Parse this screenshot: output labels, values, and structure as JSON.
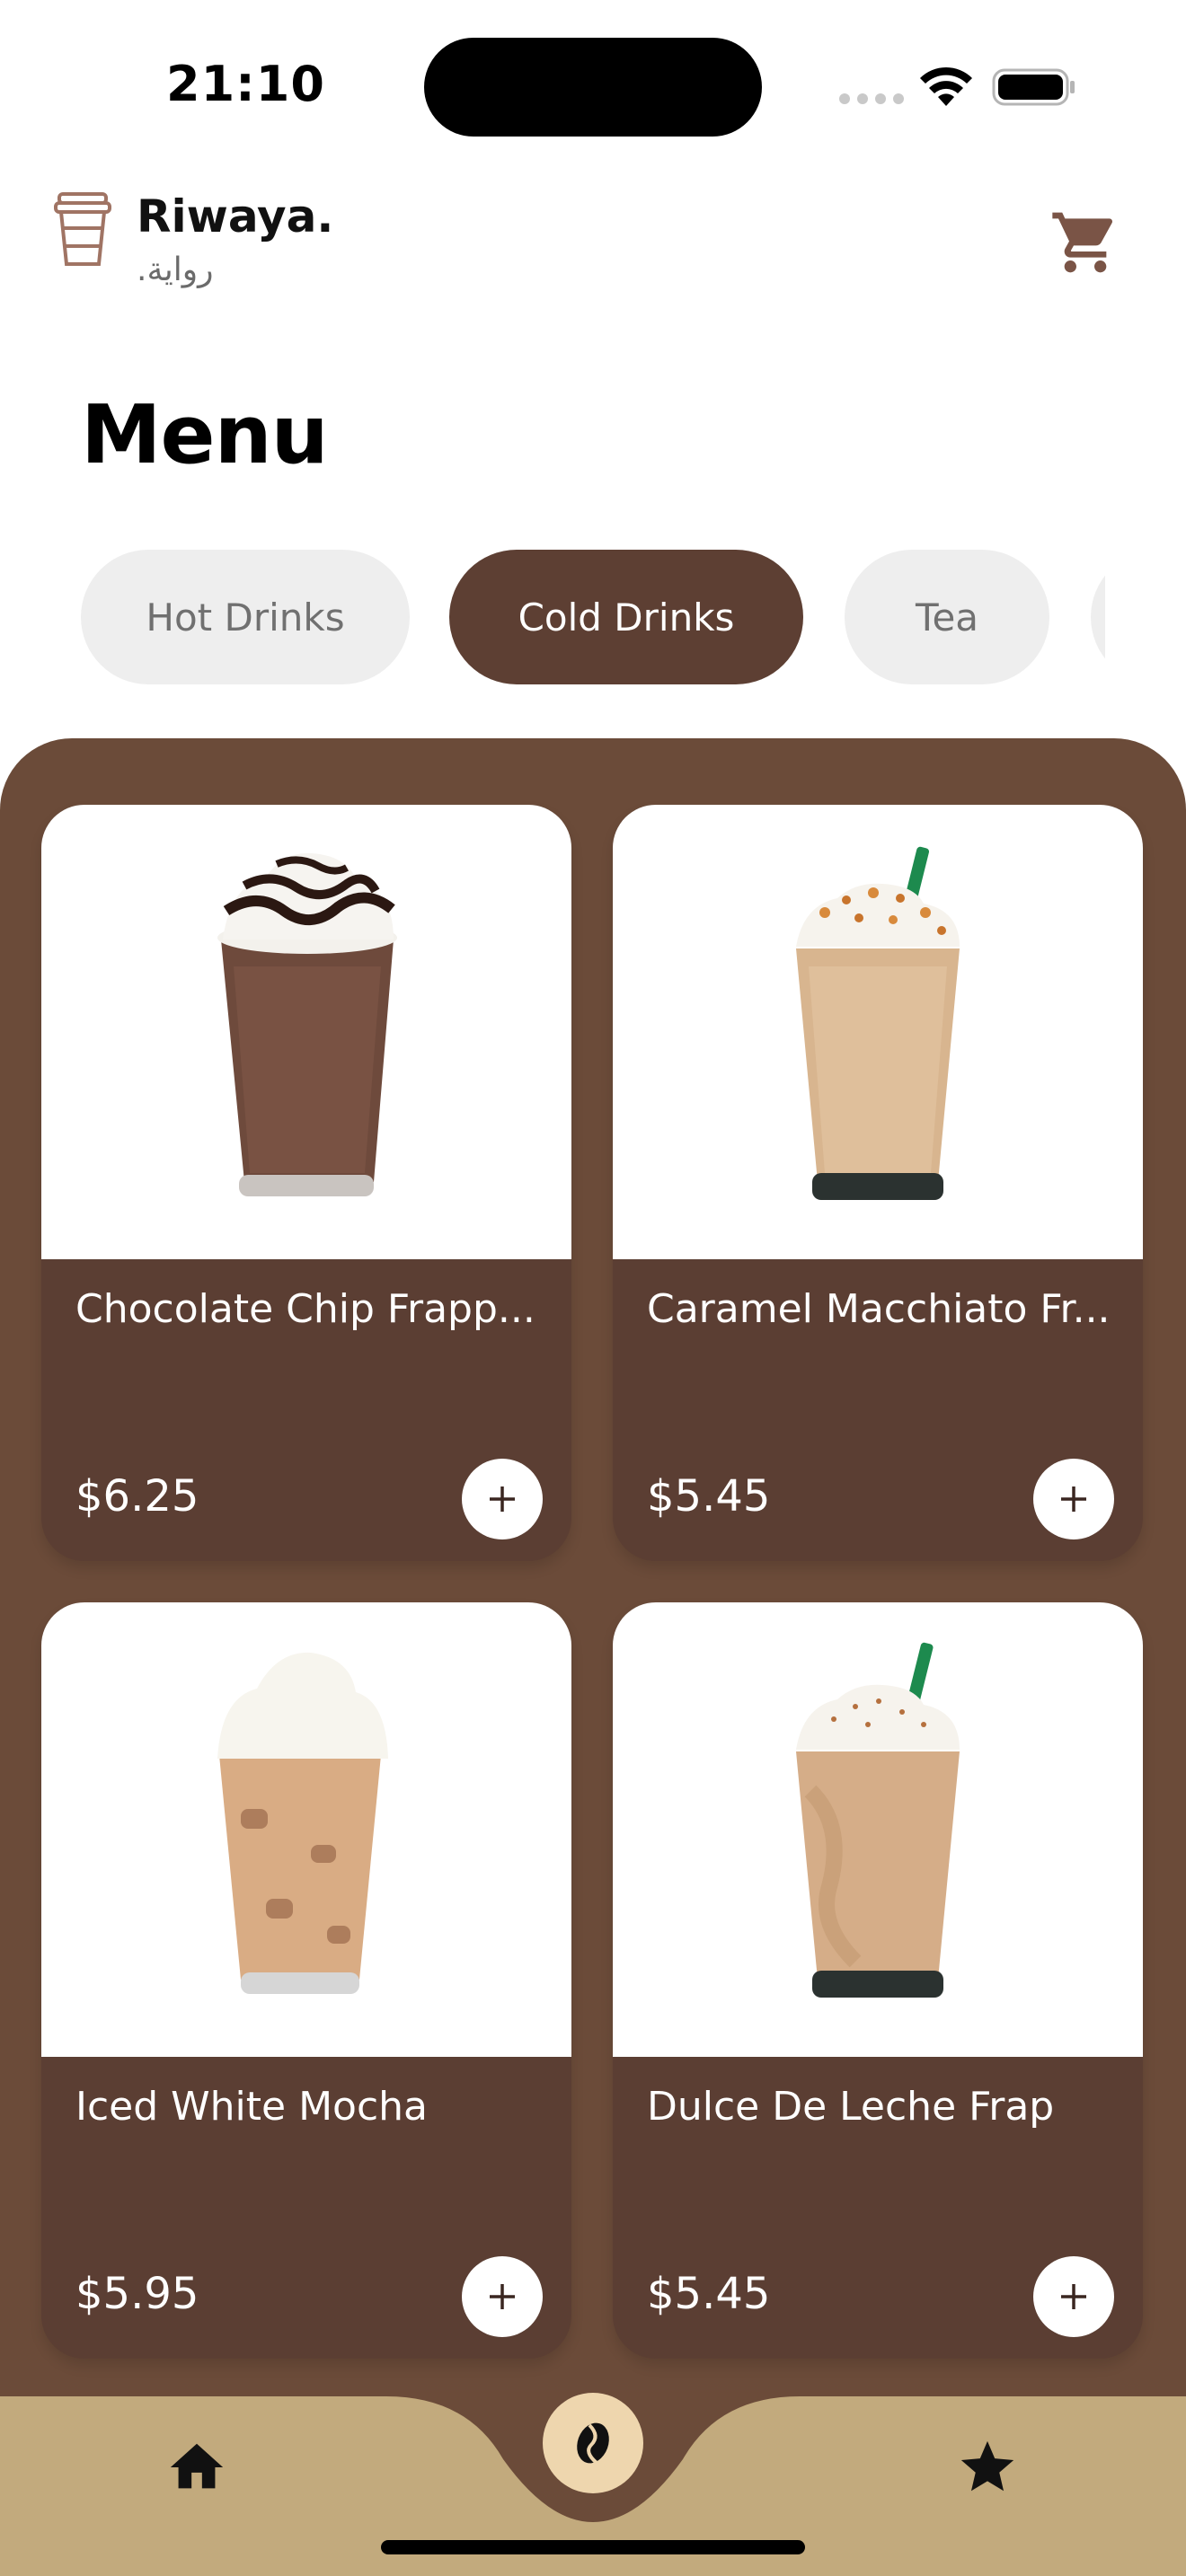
{
  "status_bar": {
    "time": "21:10",
    "icons": [
      "signal-dots-icon",
      "wifi-icon",
      "battery-icon"
    ]
  },
  "header": {
    "logo_icon": "coffee-cup-icon",
    "brand_name": "Riwaya.",
    "brand_arabic": "رواية.",
    "cart_icon": "cart-icon"
  },
  "page_title": "Menu",
  "tabs": [
    {
      "label": "Hot Drinks",
      "active": false
    },
    {
      "label": "Cold Drinks",
      "active": true
    },
    {
      "label": "Tea",
      "active": false
    },
    {
      "label": "",
      "active": false
    }
  ],
  "products": [
    {
      "name": "Chocolate Chip Frapp...",
      "price": "$6.25",
      "image_icon": "chocolate-frappuccino-image"
    },
    {
      "name": "Caramel Macchiato Fr...",
      "price": "$5.45",
      "image_icon": "caramel-frappuccino-image"
    },
    {
      "name": "Iced White Mocha",
      "price": "$5.95",
      "image_icon": "iced-white-mocha-image"
    },
    {
      "name": "Dulce De Leche Frap",
      "price": "$5.45",
      "image_icon": "dulce-de-leche-frap-image"
    }
  ],
  "bottom_nav": {
    "items": [
      "home-icon",
      "coffee-bean-icon",
      "star-icon"
    ]
  },
  "colors": {
    "accent": "#5d3f33",
    "panel": "#6b4b39",
    "nav": "#c2aa7d",
    "tab_inactive": "#eeeeee"
  }
}
